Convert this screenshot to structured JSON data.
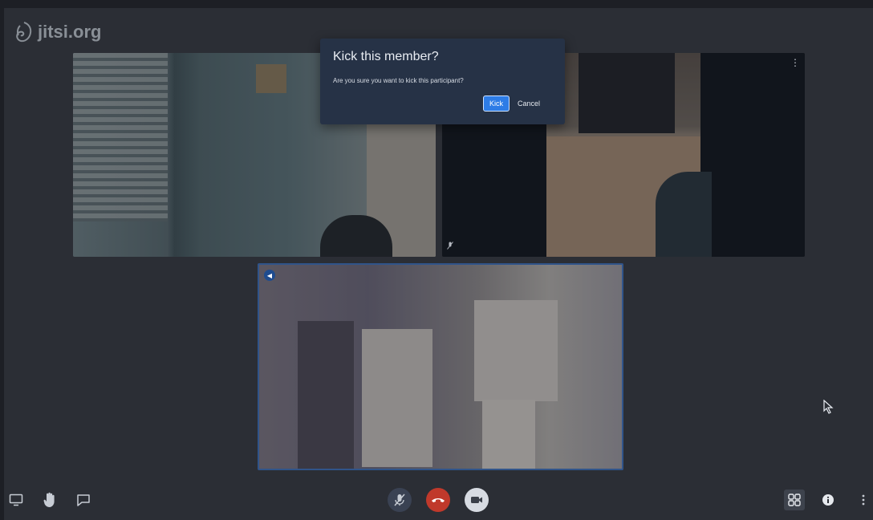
{
  "app": {
    "logo_text": "jitsi.org"
  },
  "dialog": {
    "title": "Kick this member?",
    "message": "Are you sure you want to kick this participant?",
    "confirm_label": "Kick",
    "cancel_label": "Cancel"
  },
  "toolbar": {
    "left": [
      "screenshare-icon",
      "raise-hand-icon",
      "chat-icon"
    ],
    "center": [
      "mic-muted-icon",
      "hangup-icon",
      "camera-icon"
    ],
    "right": [
      "tile-view-icon",
      "info-icon",
      "more-icon"
    ]
  },
  "colors": {
    "background": "#2b2e35",
    "dialog_bg": "#263246",
    "primary_button": "#2d7ce6",
    "hangup": "#c0392b",
    "active_speaker_border": "#30548a"
  }
}
